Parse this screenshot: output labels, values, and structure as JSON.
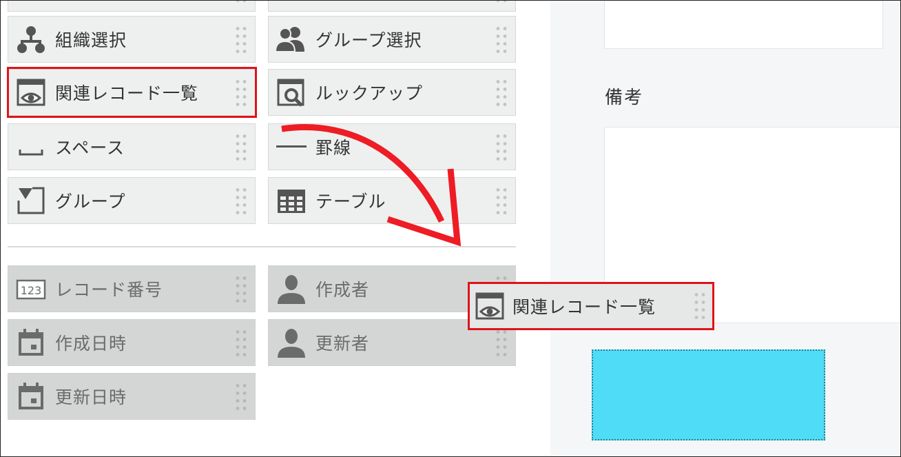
{
  "palette": {
    "standard": [
      {
        "id": "org",
        "label": "組織選択",
        "icon": "org-chart-icon"
      },
      {
        "id": "group-select",
        "label": "グループ選択",
        "icon": "users-icon"
      },
      {
        "id": "related-records",
        "label": "関連レコード一覧",
        "icon": "window-eye-icon"
      },
      {
        "id": "lookup",
        "label": "ルックアップ",
        "icon": "magnifier-window-icon"
      },
      {
        "id": "space",
        "label": "スペース",
        "icon": "space-bracket-icon"
      },
      {
        "id": "line",
        "label": "罫線",
        "icon": "horizontal-line-icon"
      },
      {
        "id": "group",
        "label": "グループ",
        "icon": "group-corner-icon"
      },
      {
        "id": "table",
        "label": "テーブル",
        "icon": "table-grid-icon"
      }
    ],
    "system": [
      {
        "id": "record-number",
        "label": "レコード番号",
        "icon": "number-123-icon"
      },
      {
        "id": "creator",
        "label": "作成者",
        "icon": "person-icon"
      },
      {
        "id": "created-datetime",
        "label": "作成日時",
        "icon": "calendar-icon"
      },
      {
        "id": "updater",
        "label": "更新者",
        "icon": "person-icon"
      },
      {
        "id": "updated-datetime",
        "label": "更新日時",
        "icon": "calendar-icon"
      }
    ]
  },
  "form": {
    "remarks_label": "備考"
  },
  "drag": {
    "label": "関連レコード一覧",
    "icon": "window-eye-icon"
  },
  "colors": {
    "highlight": "#e0131a",
    "drop_target": "#4fdcf7",
    "palette_item": "#eef0ef",
    "system_item": "#d4d6d6"
  }
}
